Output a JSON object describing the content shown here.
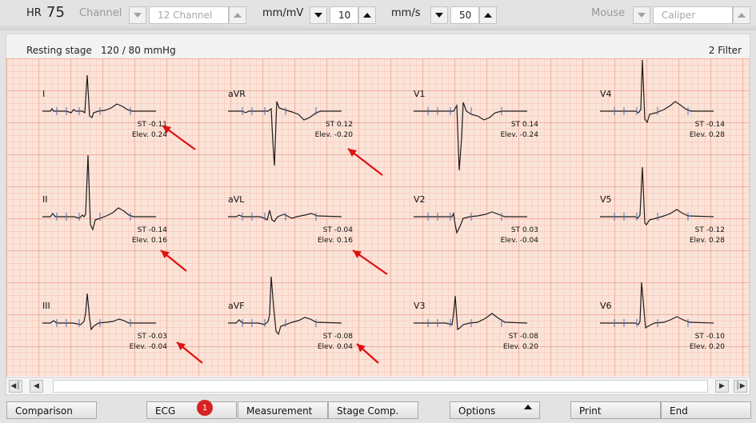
{
  "toolbar": {
    "hr_label": "HR",
    "hr_value": "75",
    "channel_label": "Channel",
    "channel_value": "12 Channel",
    "gain_unit": "mm/mV",
    "gain_value": "10",
    "speed_unit": "mm/s",
    "speed_value": "50",
    "mouse_label": "Mouse",
    "mouse_value": "Caliper"
  },
  "header": {
    "stage": "Resting stage",
    "blood_pressure": "120 / 80 mmHg",
    "filter": "2 Filter"
  },
  "leads": [
    {
      "name": "I",
      "st": "ST -0.11",
      "elev": "Elev.  0.24"
    },
    {
      "name": "aVR",
      "st": "ST  0.12",
      "elev": "Elev. -0.20"
    },
    {
      "name": "V1",
      "st": "ST  0.14",
      "elev": "Elev. -0.24"
    },
    {
      "name": "V4",
      "st": "ST -0.14",
      "elev": "Elev.  0.28"
    },
    {
      "name": "II",
      "st": "ST -0.14",
      "elev": "Elev.  0.16"
    },
    {
      "name": "aVL",
      "st": "ST -0.04",
      "elev": "Elev.  0.16"
    },
    {
      "name": "V2",
      "st": "ST  0.03",
      "elev": "Elev. -0.04"
    },
    {
      "name": "V5",
      "st": "ST -0.12",
      "elev": "Elev.  0.28"
    },
    {
      "name": "III",
      "st": "ST -0.03",
      "elev": "Elev. -0.04"
    },
    {
      "name": "aVF",
      "st": "ST -0.08",
      "elev": "Elev.  0.04"
    },
    {
      "name": "V3",
      "st": "ST -0.08",
      "elev": "Elev.  0.20"
    },
    {
      "name": "V6",
      "st": "ST -0.10",
      "elev": "Elev.  0.20"
    }
  ],
  "buttons": {
    "comparison": "Comparison",
    "ecg": "ECG",
    "ecg_badge": "1",
    "measurement": "Measurement",
    "stage_comp": "Stage Comp.",
    "options": "Options",
    "print": "Print",
    "end": "End"
  },
  "scrollbar": {
    "first_icon": "first-page-icon",
    "prev_icon": "prev-icon",
    "next_icon": "next-icon",
    "last_icon": "last-page-icon"
  },
  "colors": {
    "grid_background": "#fbe3d8",
    "trace": "#1c1c1c",
    "marker": "#4f6fb8",
    "arrow": "#e01010",
    "badge": "#d62222"
  }
}
